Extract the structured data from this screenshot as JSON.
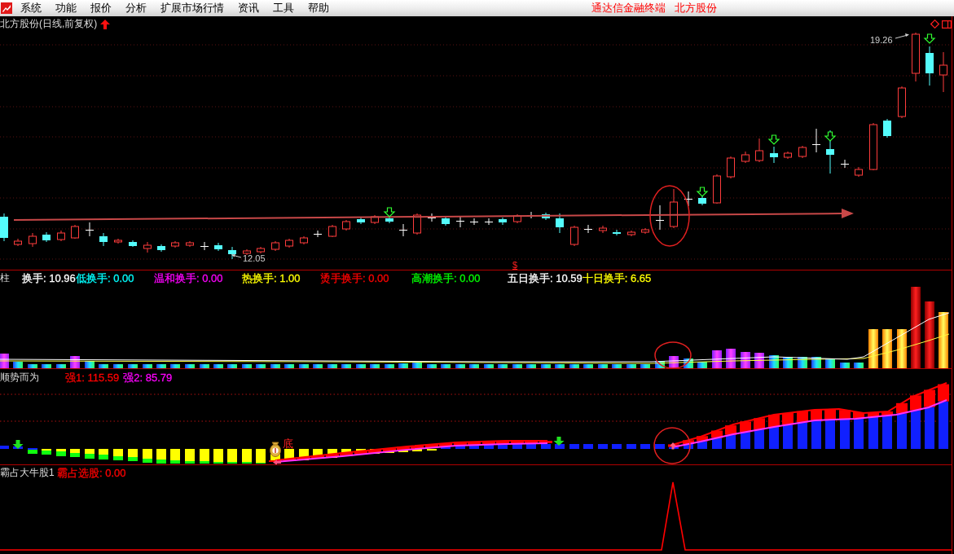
{
  "menu_bar": {
    "items": [
      "系统",
      "功能",
      "报价",
      "分析",
      "扩展市场行情",
      "资讯",
      "工具",
      "帮助"
    ],
    "app_title": "通达信金融终端",
    "stock_name": "北方股份"
  },
  "price_panel": {
    "title": "北方股份(日线,前复权)",
    "low_label": "12.05",
    "high_label": "19.26",
    "signal_mark": "$"
  },
  "volume_panel": {
    "label": "柱",
    "readings": [
      {
        "text": "换手: 10.96",
        "color": "#ffffff"
      },
      {
        "text": "低换手: 0.00",
        "color": "#00ffff"
      },
      {
        "text": "温和换手: 0.00",
        "color": "#ff00ff"
      },
      {
        "text": "热换手: 1.00",
        "color": "#ffff00"
      },
      {
        "text": "烫手换手: 0.00",
        "color": "#ff0000"
      },
      {
        "text": "高潮换手: 0.00",
        "color": "#00ff00"
      },
      {
        "text": "五日换手: 10.59",
        "color": "#ffffff"
      },
      {
        "text": "十日换手: 6.65",
        "color": "#ffff00"
      }
    ]
  },
  "trend_panel": {
    "label": "顺势而为",
    "readings": [
      {
        "text": "强1: 115.59",
        "color": "#ff0000"
      },
      {
        "text": "强2: 85.79",
        "color": "#ff00ff"
      }
    ],
    "marker_text": "底"
  },
  "signal_panel": {
    "label": "霸占大牛股1",
    "readings": [
      {
        "text": "霸占选股: 0.00",
        "color": "#ff0000"
      }
    ]
  }
}
